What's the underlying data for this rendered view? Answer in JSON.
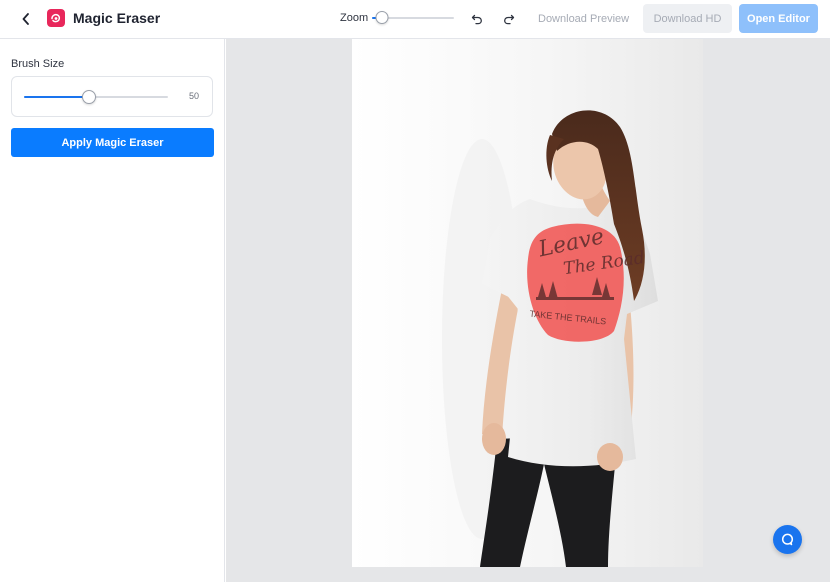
{
  "header": {
    "title": "Magic Eraser",
    "zoom_label": "Zoom",
    "zoom_level": 0.12,
    "download_preview_label": "Download Preview",
    "download_hd_label": "Download HD",
    "open_editor_label": "Open Editor"
  },
  "sidebar": {
    "brush_size_label": "Brush Size",
    "brush_size_value": "50",
    "brush_size_fraction": 0.45,
    "apply_button_label": "Apply Magic Eraser"
  },
  "canvas": {
    "photo_subject": "woman-in-white-tshirt-photo",
    "highlight_color": "#f0615f",
    "shirt_print_line1": "Leave",
    "shirt_print_line2": "The Road",
    "shirt_print_line3": "TAKE THE TRAILS"
  },
  "colors": {
    "accent": "#0a7cff",
    "brand": "#e8275b",
    "open_editor_bg": "#8ec0fb",
    "canvas_bg": "#e5e6e8"
  },
  "icons": {
    "back": "chevron-left-icon",
    "logo": "magic-eraser-logo-icon",
    "undo": "undo-icon",
    "redo": "redo-icon",
    "help": "chat-help-icon"
  }
}
